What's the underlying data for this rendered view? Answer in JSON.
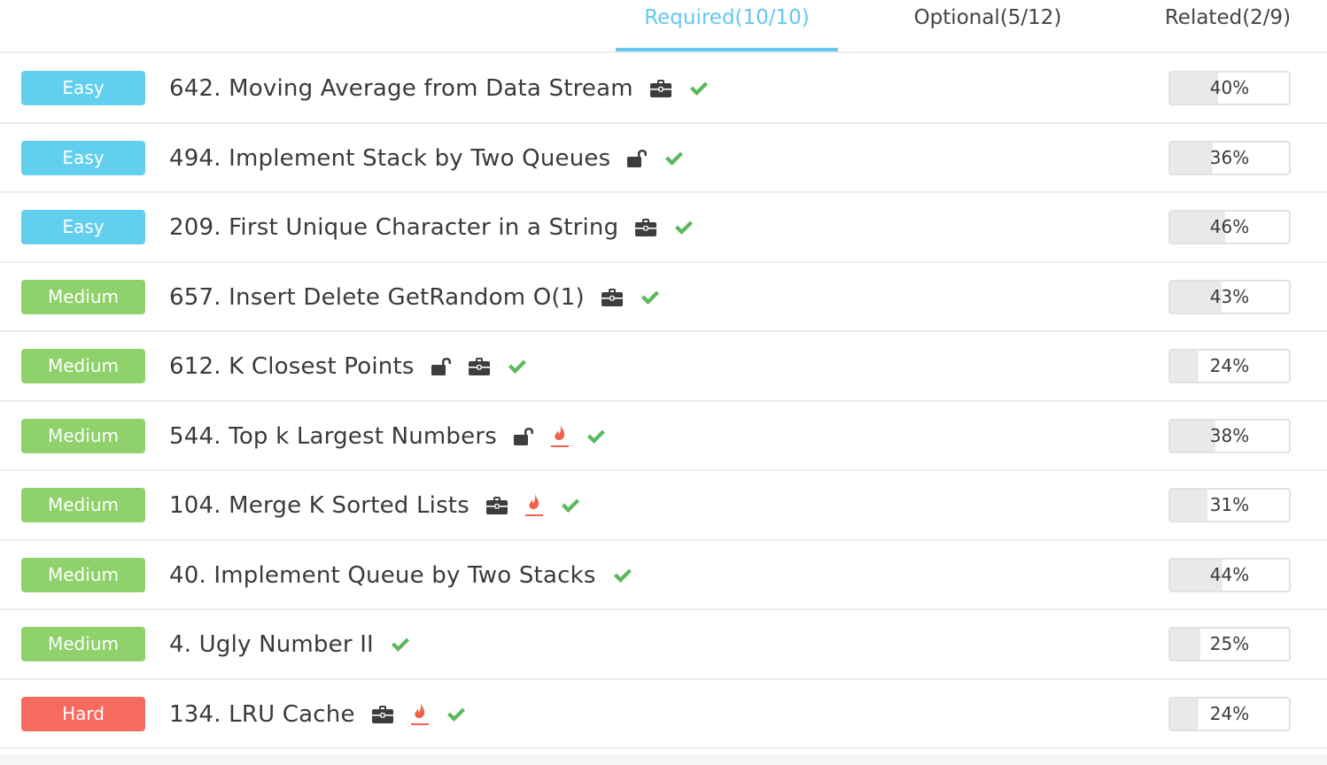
{
  "colors": {
    "accent": "#63c8ef",
    "easy": "#63cfee",
    "medium": "#8fd16a",
    "hard": "#f76b5f",
    "check": "#5cb85c",
    "hot": "#f0614d",
    "icon": "#3d3d3d"
  },
  "tabs": [
    {
      "label": "Required(10/10)",
      "active": true
    },
    {
      "label": "Optional(5/12)",
      "active": false
    },
    {
      "label": "Related(2/9)",
      "active": false
    }
  ],
  "problems": [
    {
      "difficulty": "Easy",
      "level": "easy",
      "title": "642. Moving Average from Data Stream",
      "icons": [
        "briefcase-icon",
        "check-icon"
      ],
      "progress_label": "40%",
      "progress": 40
    },
    {
      "difficulty": "Easy",
      "level": "easy",
      "title": "494. Implement Stack by Two Queues",
      "icons": [
        "unlock-icon",
        "check-icon"
      ],
      "progress_label": "36%",
      "progress": 36
    },
    {
      "difficulty": "Easy",
      "level": "easy",
      "title": "209. First Unique Character in a String",
      "icons": [
        "briefcase-icon",
        "check-icon"
      ],
      "progress_label": "46%",
      "progress": 46
    },
    {
      "difficulty": "Medium",
      "level": "medium",
      "title": "657. Insert Delete GetRandom O(1)",
      "icons": [
        "briefcase-icon",
        "check-icon"
      ],
      "progress_label": "43%",
      "progress": 43
    },
    {
      "difficulty": "Medium",
      "level": "medium",
      "title": "612. K Closest Points",
      "icons": [
        "unlock-icon",
        "briefcase-icon",
        "check-icon"
      ],
      "progress_label": "24%",
      "progress": 24
    },
    {
      "difficulty": "Medium",
      "level": "medium",
      "title": "544. Top k Largest Numbers",
      "icons": [
        "unlock-icon",
        "hot-icon",
        "check-icon"
      ],
      "progress_label": "38%",
      "progress": 38
    },
    {
      "difficulty": "Medium",
      "level": "medium",
      "title": "104. Merge K Sorted Lists",
      "icons": [
        "briefcase-icon",
        "hot-icon",
        "check-icon"
      ],
      "progress_label": "31%",
      "progress": 31
    },
    {
      "difficulty": "Medium",
      "level": "medium",
      "title": "40. Implement Queue by Two Stacks",
      "icons": [
        "check-icon"
      ],
      "progress_label": "44%",
      "progress": 44
    },
    {
      "difficulty": "Medium",
      "level": "medium",
      "title": "4. Ugly Number II",
      "icons": [
        "check-icon"
      ],
      "progress_label": "25%",
      "progress": 25
    },
    {
      "difficulty": "Hard",
      "level": "hard",
      "title": "134. LRU Cache",
      "icons": [
        "briefcase-icon",
        "hot-icon",
        "check-icon"
      ],
      "progress_label": "24%",
      "progress": 24
    }
  ]
}
